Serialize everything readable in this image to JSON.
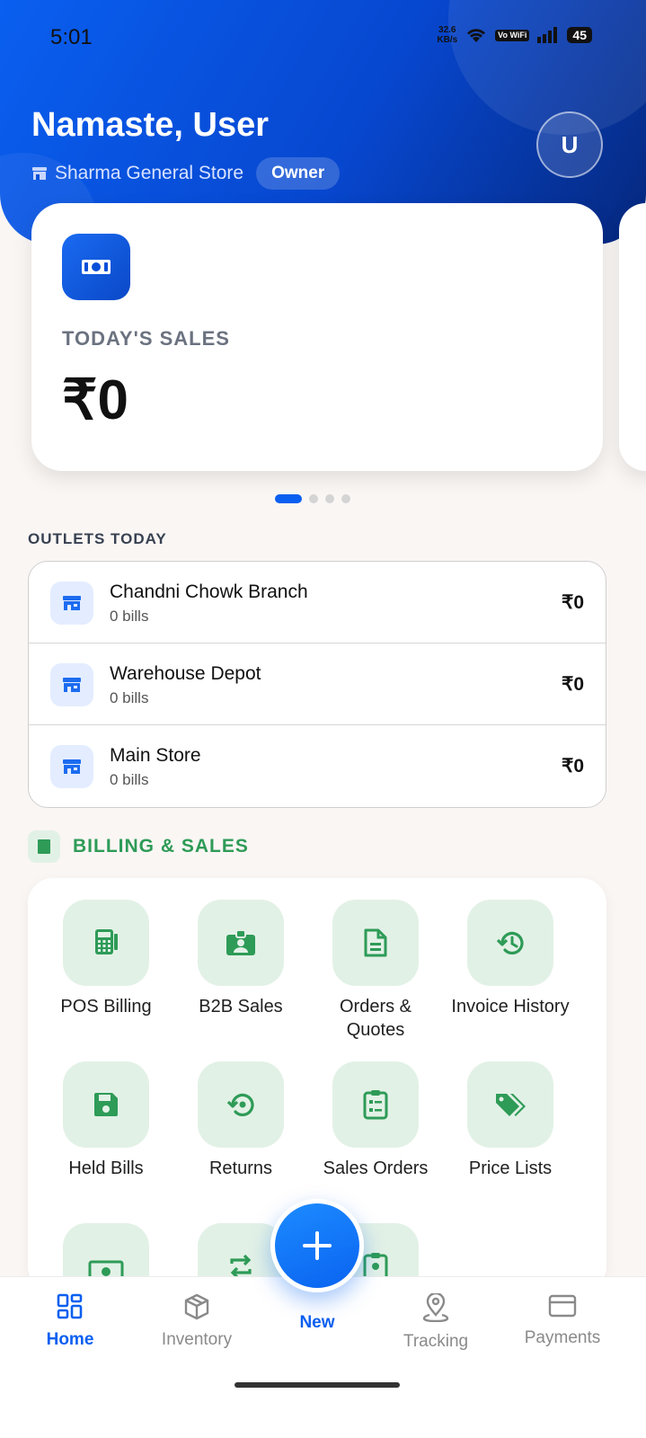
{
  "status_bar": {
    "time": "5:01",
    "speed_value": "32.6",
    "speed_unit": "KB/s",
    "volte": "Vo WiFi",
    "battery": "45",
    "icons": [
      "wifi-icon",
      "signal-icon",
      "battery-icon"
    ]
  },
  "header": {
    "greeting": "Namaste, User",
    "store_name": "Sharma General Store",
    "role": "Owner",
    "avatar_initial": "U"
  },
  "sales_card": {
    "label": "TODAY'S SALES",
    "value": "₹0",
    "icon": "cash-icon"
  },
  "carousel": {
    "count": 4,
    "active_index": 0
  },
  "outlets": {
    "title": "OUTLETS TODAY",
    "items": [
      {
        "name": "Chandni Chowk Branch",
        "bills": "0 bills",
        "amount": "₹0"
      },
      {
        "name": "Warehouse Depot",
        "bills": "0 bills",
        "amount": "₹0"
      },
      {
        "name": "Main Store",
        "bills": "0 bills",
        "amount": "₹0"
      }
    ]
  },
  "billing": {
    "title": "BILLING & SALES",
    "items": [
      {
        "label": "POS Billing",
        "icon": "pos-terminal-icon"
      },
      {
        "label": "B2B Sales",
        "icon": "id-badge-icon"
      },
      {
        "label": "Orders & Quotes",
        "icon": "document-icon"
      },
      {
        "label": "Invoice History",
        "icon": "history-icon"
      },
      {
        "label": "Held Bills",
        "icon": "save-icon"
      },
      {
        "label": "Returns",
        "icon": "return-icon"
      },
      {
        "label": "Sales Orders",
        "icon": "clipboard-list-icon"
      },
      {
        "label": "Price Lists",
        "icon": "tags-icon"
      },
      {
        "label": "",
        "icon": "money-icon"
      },
      {
        "label": "",
        "icon": "exchange-icon"
      },
      {
        "label": "",
        "icon": "clipboard-user-icon"
      }
    ]
  },
  "fab": {
    "icon": "plus-icon",
    "label": "New"
  },
  "bottom_nav": {
    "items": [
      {
        "label": "Home",
        "icon": "grid-icon",
        "active": true
      },
      {
        "label": "Inventory",
        "icon": "box-icon",
        "active": false
      },
      {
        "label": "Tracking",
        "icon": "location-pin-icon",
        "active": false
      },
      {
        "label": "Payments",
        "icon": "credit-card-icon",
        "active": false
      }
    ]
  },
  "colors": {
    "primary": "#0a5ff0",
    "header_dark": "#06287e",
    "green_accent": "#2e9b57",
    "green_tile": "#e2f1e6",
    "background": "#faf6f4"
  }
}
